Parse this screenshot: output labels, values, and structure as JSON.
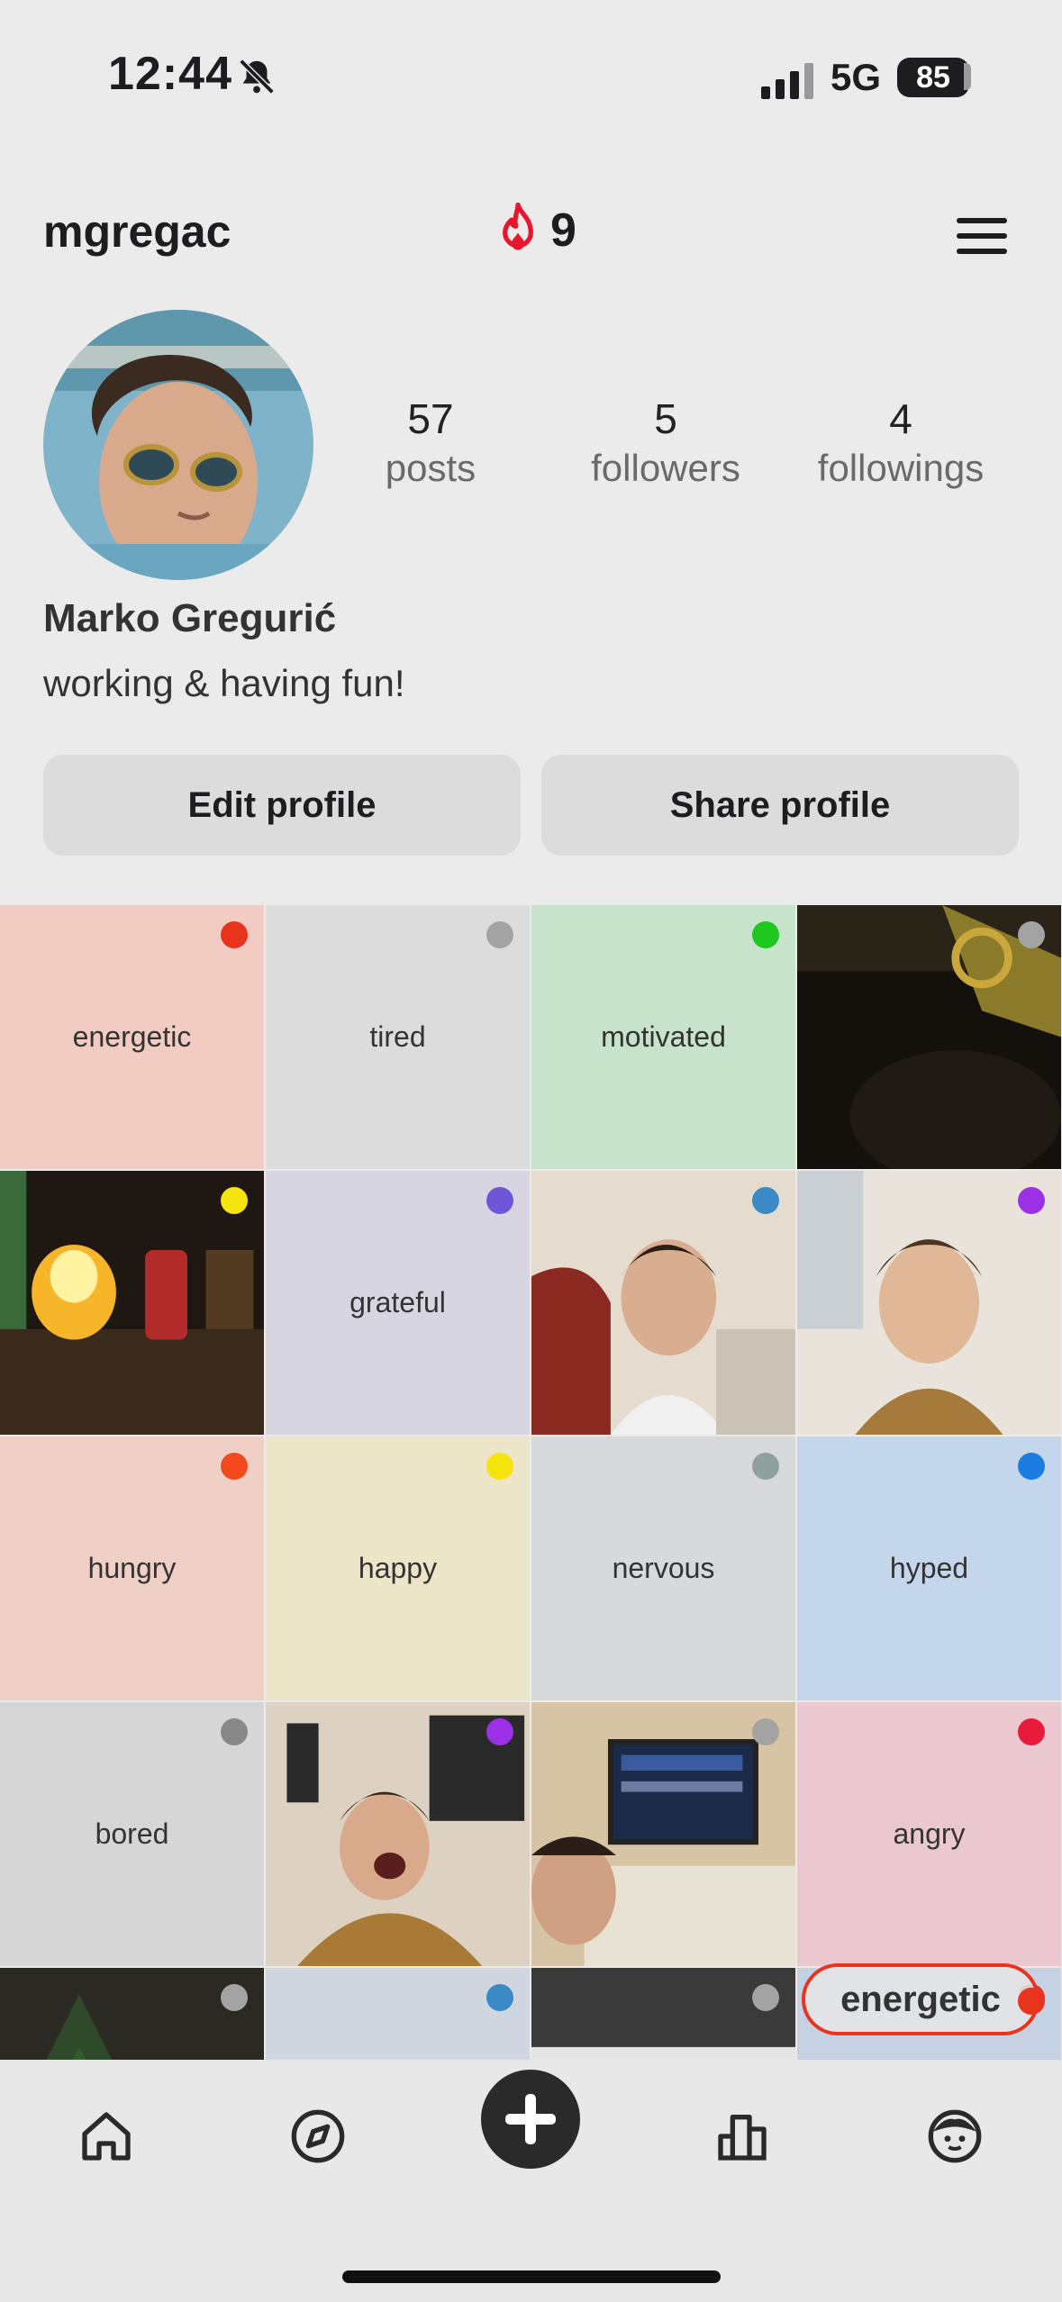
{
  "status_bar": {
    "time": "12:44",
    "network": "5G",
    "battery": "85"
  },
  "header": {
    "username": "mgregac",
    "streak_count": "9"
  },
  "profile": {
    "stats": [
      {
        "value": "57",
        "label": "posts"
      },
      {
        "value": "5",
        "label": "followers"
      },
      {
        "value": "4",
        "label": "followings"
      }
    ],
    "full_name": "Marko Gregurić",
    "bio": "working & having fun!"
  },
  "actions": {
    "edit_label": "Edit profile",
    "share_label": "Share profile"
  },
  "grid": [
    {
      "mood": "energetic",
      "bg": "#f2ccc2",
      "dot": "#e8341c"
    },
    {
      "mood": "tired",
      "bg": "#dcdcdc",
      "dot": "#a3a3a3"
    },
    {
      "mood": "motivated",
      "bg": "#c7e3cb",
      "dot": "#1ec71e"
    },
    {
      "mood": "",
      "bg": "#1a1510",
      "dot": "#a3a3a3",
      "photo": "dark-car"
    },
    {
      "mood": "",
      "bg": "#2a2016",
      "dot": "#f5e40e",
      "photo": "candle"
    },
    {
      "mood": "grateful",
      "bg": "#d8d5e3",
      "dot": "#6d57d6",
      "photo": ""
    },
    {
      "mood": "",
      "bg": "#cbb8a5",
      "dot": "#3a8ac6",
      "photo": "selfie1"
    },
    {
      "mood": "",
      "bg": "#d9c6b3",
      "dot": "#9b30e6",
      "photo": "selfie2"
    },
    {
      "mood": "hungry",
      "bg": "#f0cfc7",
      "dot": "#f24a1c"
    },
    {
      "mood": "happy",
      "bg": "#ece5c8",
      "dot": "#f5e40e"
    },
    {
      "mood": "nervous",
      "bg": "#d8d9da",
      "dot": "#8fa19c"
    },
    {
      "mood": "hyped",
      "bg": "#c3d6ec",
      "dot": "#1a7be0"
    },
    {
      "mood": "bored",
      "bg": "#d6d6d6",
      "dot": "#888888"
    },
    {
      "mood": "",
      "bg": "#b9ada0",
      "dot": "#9b30e6",
      "photo": "laugh"
    },
    {
      "mood": "",
      "bg": "#d3c2a4",
      "dot": "#a3a3a3",
      "photo": "desk"
    },
    {
      "mood": "angry",
      "bg": "#ebc8d0",
      "dot": "#e81c3a"
    },
    {
      "mood": "",
      "bg": "#2c3a28",
      "dot": "#a3a3a3",
      "photo": "tree"
    },
    {
      "mood": "",
      "bg": "#cfd6e0",
      "dot": "#3a8ac6",
      "photo": ""
    },
    {
      "mood": "",
      "bg": "#dadada",
      "dot": "#a3a3a3",
      "photo": "screen"
    },
    {
      "mood": "",
      "bg": "#c6d2e3",
      "dot": "#e8341c",
      "photo": ""
    }
  ],
  "overlay_tag": {
    "label": "energetic"
  },
  "tabbar": {
    "tabs": [
      "home",
      "explore",
      "add",
      "stats",
      "profile"
    ]
  }
}
